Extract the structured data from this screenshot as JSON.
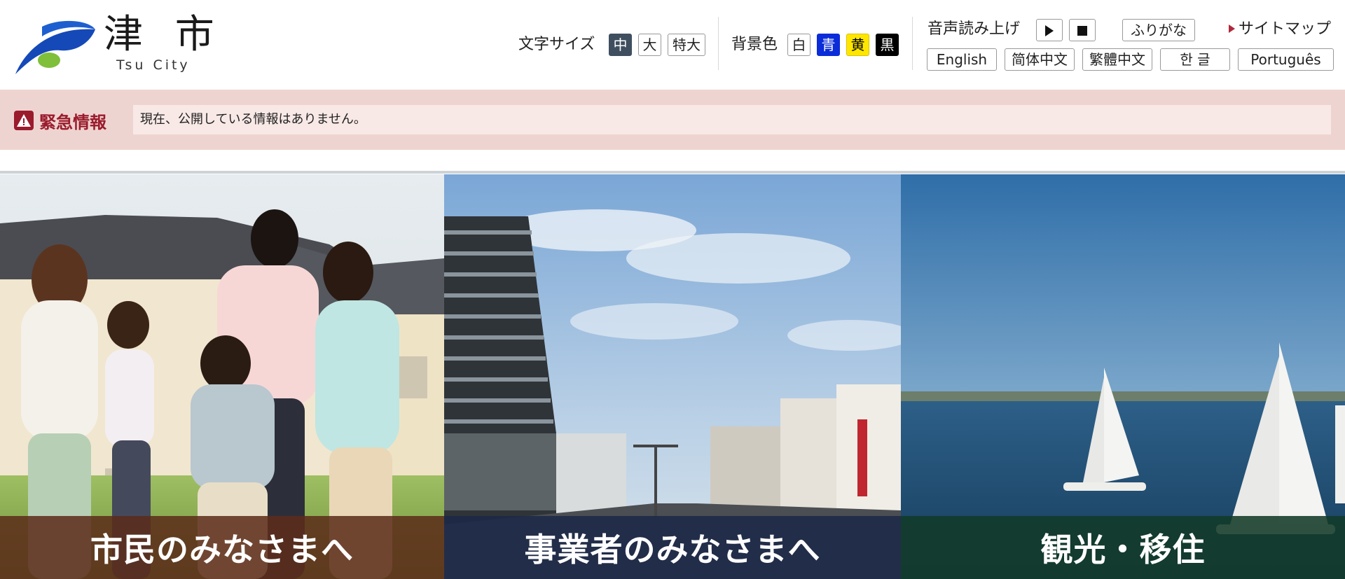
{
  "logo": {
    "kanji": "津 市",
    "roman": "Tsu City"
  },
  "font_size": {
    "label": "文字サイズ",
    "options": [
      "中",
      "大",
      "特大"
    ],
    "selected": "中"
  },
  "bg_color": {
    "label": "背景色",
    "options": [
      {
        "label": "白",
        "color": "#ffffff"
      },
      {
        "label": "青",
        "color": "#0a2cd9"
      },
      {
        "label": "黄",
        "color": "#ffe600"
      },
      {
        "label": "黒",
        "color": "#000000"
      }
    ]
  },
  "read_aloud": {
    "label": "音声読み上げ",
    "play_icon": "play-icon",
    "stop_icon": "stop-icon"
  },
  "furigana_label": "ふりがな",
  "sitemap_label": "サイトマップ",
  "languages": [
    "English",
    "简体中文",
    "繁體中文",
    "한 글",
    "Português"
  ],
  "emergency": {
    "title": "緊急情報",
    "message": "現在、公開している情報はありません。",
    "icon": "warning-icon"
  },
  "panels": [
    {
      "label": "市民のみなさまへ"
    },
    {
      "label": "事業者のみなさまへ"
    },
    {
      "label": "観光・移住"
    }
  ],
  "colors": {
    "emergency_bg": "#eed4d0",
    "emergency_text": "#9a1b2c",
    "active_font_btn": "#3f4f5f"
  }
}
